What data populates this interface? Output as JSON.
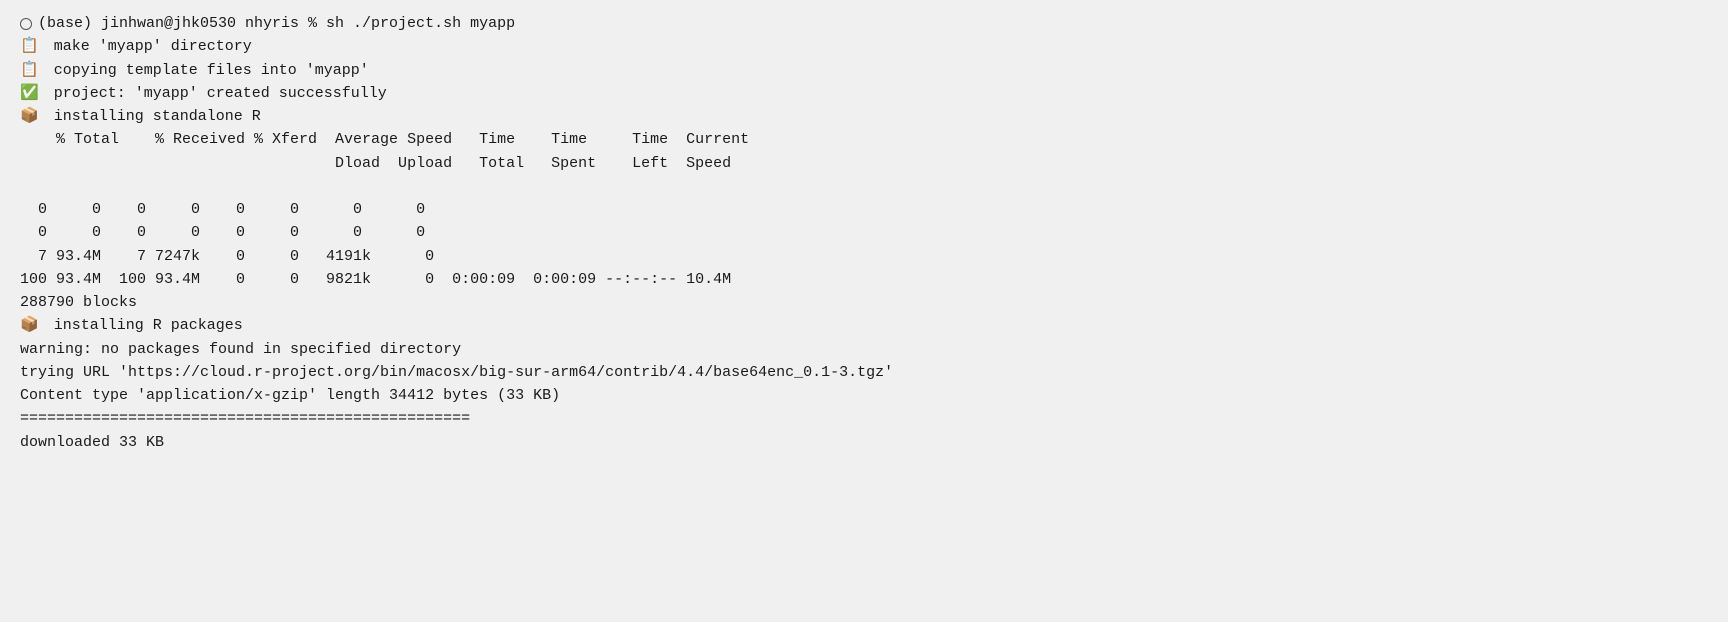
{
  "terminal": {
    "prompt": "(base) jinhwan@jhk0530 nhyris % sh ./project.sh myapp",
    "lines": [
      {
        "icon": "📋",
        "text": " make 'myapp' directory"
      },
      {
        "icon": "📋",
        "text": " copying template files into 'myapp'"
      },
      {
        "icon": "✅",
        "text": " project: 'myapp' created successfully"
      },
      {
        "icon": "📦",
        "text": " installing standalone R"
      },
      {
        "icon": "",
        "text": "  % Total    % Received % Xferd  Average Speed   Time    Time     Time  Current"
      },
      {
        "icon": "",
        "text": "                                 Dload  Upload   Total   Spent    Left  Speed"
      },
      {
        "icon": "",
        "text": "  0     0    0     0    0     0      0      0"
      },
      {
        "icon": "",
        "text": "  0     0    0     0    0     0      0      0"
      },
      {
        "icon": "",
        "text": "  7 93.4M    7 7247k    0     0   4191k      0"
      },
      {
        "icon": "",
        "text": "100 93.4M  100 93.4M    0     0   9821k      0  0:00:09  0:00:09 --:--:-- 10.4M"
      },
      {
        "icon": "",
        "text": "288790 blocks"
      },
      {
        "icon": "📦",
        "text": " installing R packages"
      },
      {
        "icon": "",
        "text": "warning: no packages found in specified directory"
      },
      {
        "icon": "",
        "text": "trying URL 'https://cloud.r-project.org/bin/macosx/big-sur-arm64/contrib/4.4/base64enc_0.1-3.tgz'"
      },
      {
        "icon": "",
        "text": "Content type 'application/x-gzip' length 34412 bytes (33 KB)"
      },
      {
        "icon": "",
        "text": "=================================================="
      },
      {
        "icon": "",
        "text": "downloaded 33 KB"
      }
    ]
  }
}
